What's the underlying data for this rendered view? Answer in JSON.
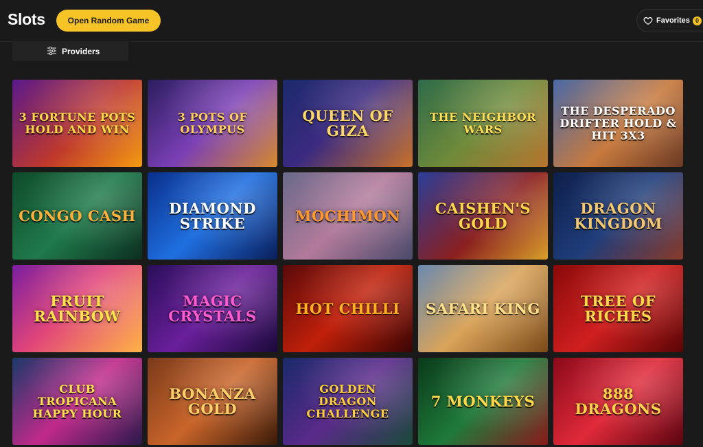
{
  "header": {
    "title": "Slots",
    "random_button": "Open Random Game",
    "favorites_label": "Favorites",
    "favorites_count": "0"
  },
  "filters": {
    "providers_label": "Providers"
  },
  "games": [
    {
      "name": "3 Fortune Pots Hold and Win",
      "bg": "linear-gradient(135deg,#5a1a8c,#c0392b 55%,#f39c12)",
      "color": "#ffd84a"
    },
    {
      "name": "3 Pots of Olympus",
      "bg": "linear-gradient(135deg,#2b1e5e,#7a3fb5 50%,#d68a2e)",
      "color": "#ffcf5a"
    },
    {
      "name": "Queen of Giza",
      "bg": "linear-gradient(135deg,#1b2a6b,#3b2a80 45%,#c9732a)",
      "color": "#ffd766"
    },
    {
      "name": "The Neighbor Wars",
      "bg": "linear-gradient(135deg,#2e6b4a,#6e8a3a 50%,#b7752e)",
      "color": "#ffdd55"
    },
    {
      "name": "The Desperado Drifter Hold & Hit 3x3",
      "bg": "linear-gradient(135deg,#4a6aa8,#c77a3e 55%,#6b3a25)",
      "color": "#ffffff"
    },
    {
      "name": "Congo Cash",
      "bg": "linear-gradient(135deg,#0f4a2a,#1f7a4a 50%,#0c2e20)",
      "color": "#ffb13b"
    },
    {
      "name": "Diamond Strike",
      "bg": "linear-gradient(135deg,#0a2f8a,#1f6fe0 50%,#0b1f5a)",
      "color": "#ffffff"
    },
    {
      "name": "Mochimon",
      "bg": "linear-gradient(135deg,#6a6a8a,#b27a9a 50%,#4a4a6a)",
      "color": "#ff9a2a"
    },
    {
      "name": "Caishen's Gold",
      "bg": "linear-gradient(135deg,#2c3f9a,#8a1f1f 55%,#d9a02a)",
      "color": "#ffd54a"
    },
    {
      "name": "Dragon Kingdom",
      "bg": "linear-gradient(135deg,#0e1f4a,#1f3d7a 50%,#8a3a2a)",
      "color": "#f3c870"
    },
    {
      "name": "Fruit Rainbow",
      "bg": "linear-gradient(135deg,#7a1fa0,#e0457a 45%,#ffb347)",
      "color": "#ffe24a"
    },
    {
      "name": "Magic Crystals",
      "bg": "linear-gradient(135deg,#2a0f5a,#6a1f9a 50%,#1a0a3a)",
      "color": "#ff5ad0"
    },
    {
      "name": "Hot Chilli",
      "bg": "linear-gradient(135deg,#5a0a0a,#c0200a 50%,#3a0505)",
      "color": "#ffb020"
    },
    {
      "name": "Safari King",
      "bg": "linear-gradient(135deg,#6a8ab0,#d9a45a 50%,#7a4a1a)",
      "color": "#ffe08a"
    },
    {
      "name": "Tree of Riches",
      "bg": "linear-gradient(135deg,#8a0a0a,#d01f1f 50%,#5a0505)",
      "color": "#ffd84a"
    },
    {
      "name": "Club Tropicana Happy Hour",
      "bg": "linear-gradient(135deg,#1a3a6a,#c02a8a 50%,#2a1a4a)",
      "color": "#ffe24a"
    },
    {
      "name": "Bonanza Gold",
      "bg": "linear-gradient(135deg,#7a3a1a,#c9652a 50%,#3a1a0a)",
      "color": "#ffd06a"
    },
    {
      "name": "Golden Dragon Challenge",
      "bg": "linear-gradient(135deg,#1a2a6a,#5a2a8a 50%,#1a4a3a)",
      "color": "#ffcf3a"
    },
    {
      "name": "7 Monkeys",
      "bg": "linear-gradient(135deg,#0a3a1a,#1f7a3a 50%,#8a1a1a)",
      "color": "#ffd84a"
    },
    {
      "name": "888 Dragons",
      "bg": "linear-gradient(135deg,#8a0a1a,#e02a3a 50%,#5a0510)",
      "color": "#ffd24a"
    }
  ]
}
